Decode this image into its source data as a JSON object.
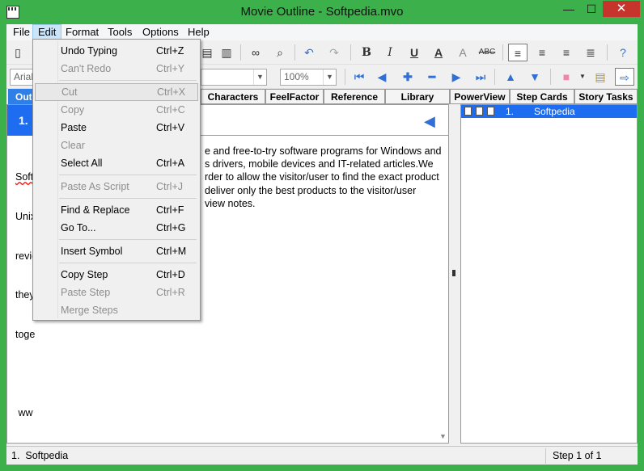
{
  "window": {
    "title": "Movie Outline - Softpedia.mvo",
    "minimize": "—",
    "maximize": "☐",
    "close": "✕"
  },
  "menu": [
    "File",
    "Edit",
    "Format",
    "Tools",
    "Options",
    "Help"
  ],
  "toolbar2": {
    "font": "Arial",
    "zoom": "100%"
  },
  "tabs": [
    "Outline",
    "Characters",
    "FeelFactor",
    "Reference",
    "Library",
    "PowerView",
    "Step Cards",
    "Story Tasks"
  ],
  "step": {
    "number": "1.",
    "text_visible": "Softpedia is a library of over free and free-to-try software programs for Windows and\nUnix/Linux, Mac, Mobile, as well as drivers, mobile devices and IT-related articles.We\nreview and categorize these in order to allow the visitor/user to find the exact product\nthey and their system needs. We deliver only the best products to the visitor/user\ntogether with self-made evaluation and review notes.\n\n www.softpedia.com"
  },
  "body_lines": [
    "Softp",
    "Unix",
    "revie",
    "they",
    "toge",
    "",
    " ww"
  ],
  "body_right": [
    "e and free-to-try software programs for Windows and",
    "s drivers, mobile devices and IT-related articles.We",
    "rder to allow the visitor/user to find the exact product",
    "deliver only the best products to the visitor/user",
    "view notes.",
    "",
    ""
  ],
  "outline": {
    "number": "1.",
    "title": "Softpedia"
  },
  "status": {
    "left": "1.  Softpedia",
    "right": "Step 1 of 1"
  },
  "edit_menu": [
    {
      "label": "Undo Typing",
      "shortcut": "Ctrl+Z",
      "enabled": true
    },
    {
      "label": "Can't Redo",
      "shortcut": "Ctrl+Y",
      "enabled": false
    },
    {
      "label": "Cut",
      "shortcut": "Ctrl+X",
      "enabled": false
    },
    {
      "label": "Copy",
      "shortcut": "Ctrl+C",
      "enabled": false
    },
    {
      "label": "Paste",
      "shortcut": "Ctrl+V",
      "enabled": true
    },
    {
      "label": "Clear",
      "shortcut": "",
      "enabled": false
    },
    {
      "label": "Select All",
      "shortcut": "Ctrl+A",
      "enabled": true
    },
    {
      "label": "Paste As Script",
      "shortcut": "Ctrl+J",
      "enabled": false
    },
    {
      "label": "Find & Replace",
      "shortcut": "Ctrl+F",
      "enabled": true
    },
    {
      "label": "Go To...",
      "shortcut": "Ctrl+G",
      "enabled": true
    },
    {
      "label": "Insert Symbol",
      "shortcut": "Ctrl+M",
      "enabled": true
    },
    {
      "label": "Copy Step",
      "shortcut": "Ctrl+D",
      "enabled": true
    },
    {
      "label": "Paste Step",
      "shortcut": "Ctrl+R",
      "enabled": false
    },
    {
      "label": "Merge Steps",
      "shortcut": "",
      "enabled": false
    }
  ],
  "colors": {
    "frame": "#3cb04a",
    "selection": "#1e6df0",
    "tab_selected": "#2f7fe6"
  }
}
